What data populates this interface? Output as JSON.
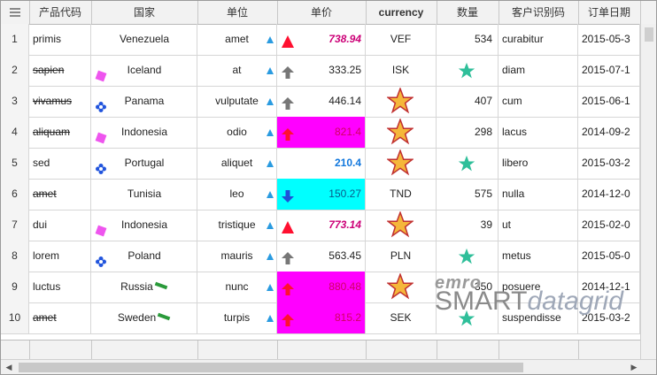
{
  "header": {
    "menu_icon": "menu-icon",
    "columns": [
      "产品代码",
      "国家",
      "单位",
      "单价",
      "currency",
      "数量",
      "客户识别码",
      "订单日期"
    ]
  },
  "rows": [
    {
      "num": "1",
      "code": "primis",
      "strike": false,
      "flag": "none",
      "country": "Venezuela",
      "unit": "amet",
      "trend": "up-red",
      "price": "738.94",
      "price_style": "bold-magenta",
      "currency": "VEF",
      "qty": "534",
      "qty_icon": "none",
      "customer": "curabitur",
      "date": "2015-05-3"
    },
    {
      "num": "2",
      "code": "sapien",
      "strike": true,
      "flag": "pink-square",
      "country": "Iceland",
      "unit": "at",
      "trend": "up-gray",
      "price": "333.25",
      "price_style": "normal",
      "currency": "ISK",
      "qty": "",
      "qty_icon": "teal-star",
      "customer": "diam",
      "date": "2015-07-1"
    },
    {
      "num": "3",
      "code": "vivamus",
      "strike": true,
      "flag": "blue-cross",
      "country": "Panama",
      "unit": "vulputate",
      "trend": "up-gray",
      "price": "446.14",
      "price_style": "normal",
      "currency": "",
      "currency_icon": "orange-star",
      "qty": "407",
      "qty_icon": "none",
      "customer": "cum",
      "date": "2015-06-1"
    },
    {
      "num": "4",
      "code": "aliquam",
      "strike": true,
      "flag": "pink-square",
      "country": "Indonesia",
      "unit": "odio",
      "trend": "up-red-arrow",
      "price": "821.4",
      "price_style": "magenta-bg",
      "currency": "",
      "currency_icon": "orange-star",
      "qty": "298",
      "qty_icon": "none",
      "customer": "lacus",
      "date": "2014-09-2"
    },
    {
      "num": "5",
      "code": "sed",
      "strike": false,
      "flag": "blue-cross",
      "country": "Portugal",
      "unit": "aliquet",
      "trend": "none",
      "price": "210.4",
      "price_style": "bold-blue",
      "currency": "",
      "currency_icon": "orange-star",
      "qty": "",
      "qty_icon": "teal-star",
      "customer": "libero",
      "date": "2015-03-2"
    },
    {
      "num": "6",
      "code": "amet",
      "strike": true,
      "flag": "none",
      "country": "Tunisia",
      "unit": "leo",
      "trend": "down-blue",
      "price": "150.27",
      "price_style": "cyan-bg",
      "currency": "TND",
      "qty": "575",
      "qty_icon": "none",
      "customer": "nulla",
      "date": "2014-12-0"
    },
    {
      "num": "7",
      "code": "dui",
      "strike": false,
      "flag": "pink-square",
      "country": "Indonesia",
      "unit": "tristique",
      "trend": "up-red",
      "price": "773.14",
      "price_style": "bold-magenta",
      "currency": "",
      "currency_icon": "orange-star",
      "qty": "39",
      "qty_icon": "none",
      "customer": "ut",
      "date": "2015-02-0"
    },
    {
      "num": "8",
      "code": "lorem",
      "strike": false,
      "flag": "blue-cross",
      "country": "Poland",
      "unit": "mauris",
      "trend": "up-gray",
      "price": "563.45",
      "price_style": "normal",
      "currency": "PLN",
      "qty": "",
      "qty_icon": "teal-star",
      "customer": "metus",
      "date": "2015-05-0"
    },
    {
      "num": "9",
      "code": "luctus",
      "strike": false,
      "flag": "green-bar",
      "country": "Russia",
      "unit": "nunc",
      "trend": "up-red-arrow",
      "price": "880.48",
      "price_style": "magenta-bg",
      "currency": "",
      "currency_icon": "orange-star",
      "qty": "350",
      "qty_icon": "none",
      "customer": "posuere",
      "date": "2014-12-1"
    },
    {
      "num": "10",
      "code": "amet",
      "strike": true,
      "flag": "green-bar",
      "country": "Sweden",
      "unit": "turpis",
      "trend": "up-red-arrow",
      "price": "815.2",
      "price_style": "magenta-bg",
      "currency": "SEK",
      "qty": "",
      "qty_icon": "teal-star",
      "customer": "suspendisse",
      "date": "2015-03-2"
    }
  ],
  "watermark": {
    "line1": "emro",
    "line2_a": "SMART",
    "line2_b": "datagrid"
  },
  "colors": {
    "magenta": "#ff00ff",
    "cyan": "#00ffff",
    "teal_star": "#2fbf9a",
    "orange_star": "#f5b73a",
    "blue_triangle": "#2a9be0",
    "red_arrow": "#ff1030"
  }
}
